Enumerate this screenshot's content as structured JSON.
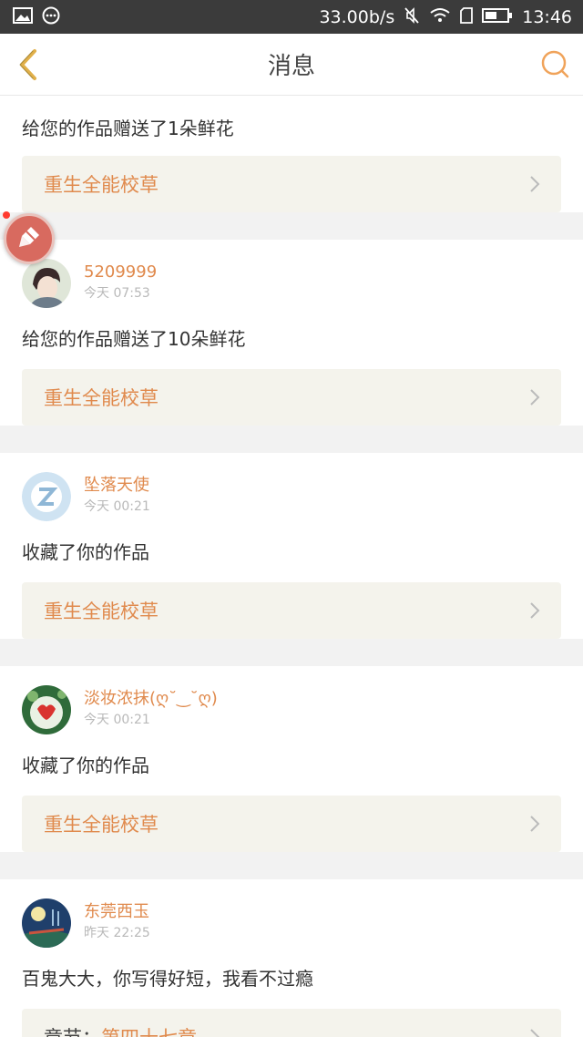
{
  "status_bar": {
    "speed": "33.00b/s",
    "time": "13:46"
  },
  "nav": {
    "title": "消息"
  },
  "colors": {
    "accent": "#e08a4d",
    "link_bg": "#f4f3ec",
    "status_bg": "#3b3b3b"
  },
  "items": [
    {
      "message": "给您的作品赠送了1朵鲜花",
      "book": "重生全能校草"
    },
    {
      "user": "5209999",
      "time": "今天 07:53",
      "message": "给您的作品赠送了10朵鲜花",
      "book": "重生全能校草"
    },
    {
      "user": "坠落天使",
      "time": "今天 00:21",
      "message": "收藏了你的作品",
      "book": "重生全能校草"
    },
    {
      "user": "淡妆浓抹(ღ˘‿˘ღ)",
      "time": "今天 00:21",
      "message": "收藏了你的作品",
      "book": "重生全能校草"
    },
    {
      "user": "东莞西玉",
      "time": "昨天 22:25",
      "message": "百鬼大大，你写得好短，我看不过瘾",
      "chapter_prefix": "章节：",
      "chapter": "第四十七章"
    }
  ]
}
